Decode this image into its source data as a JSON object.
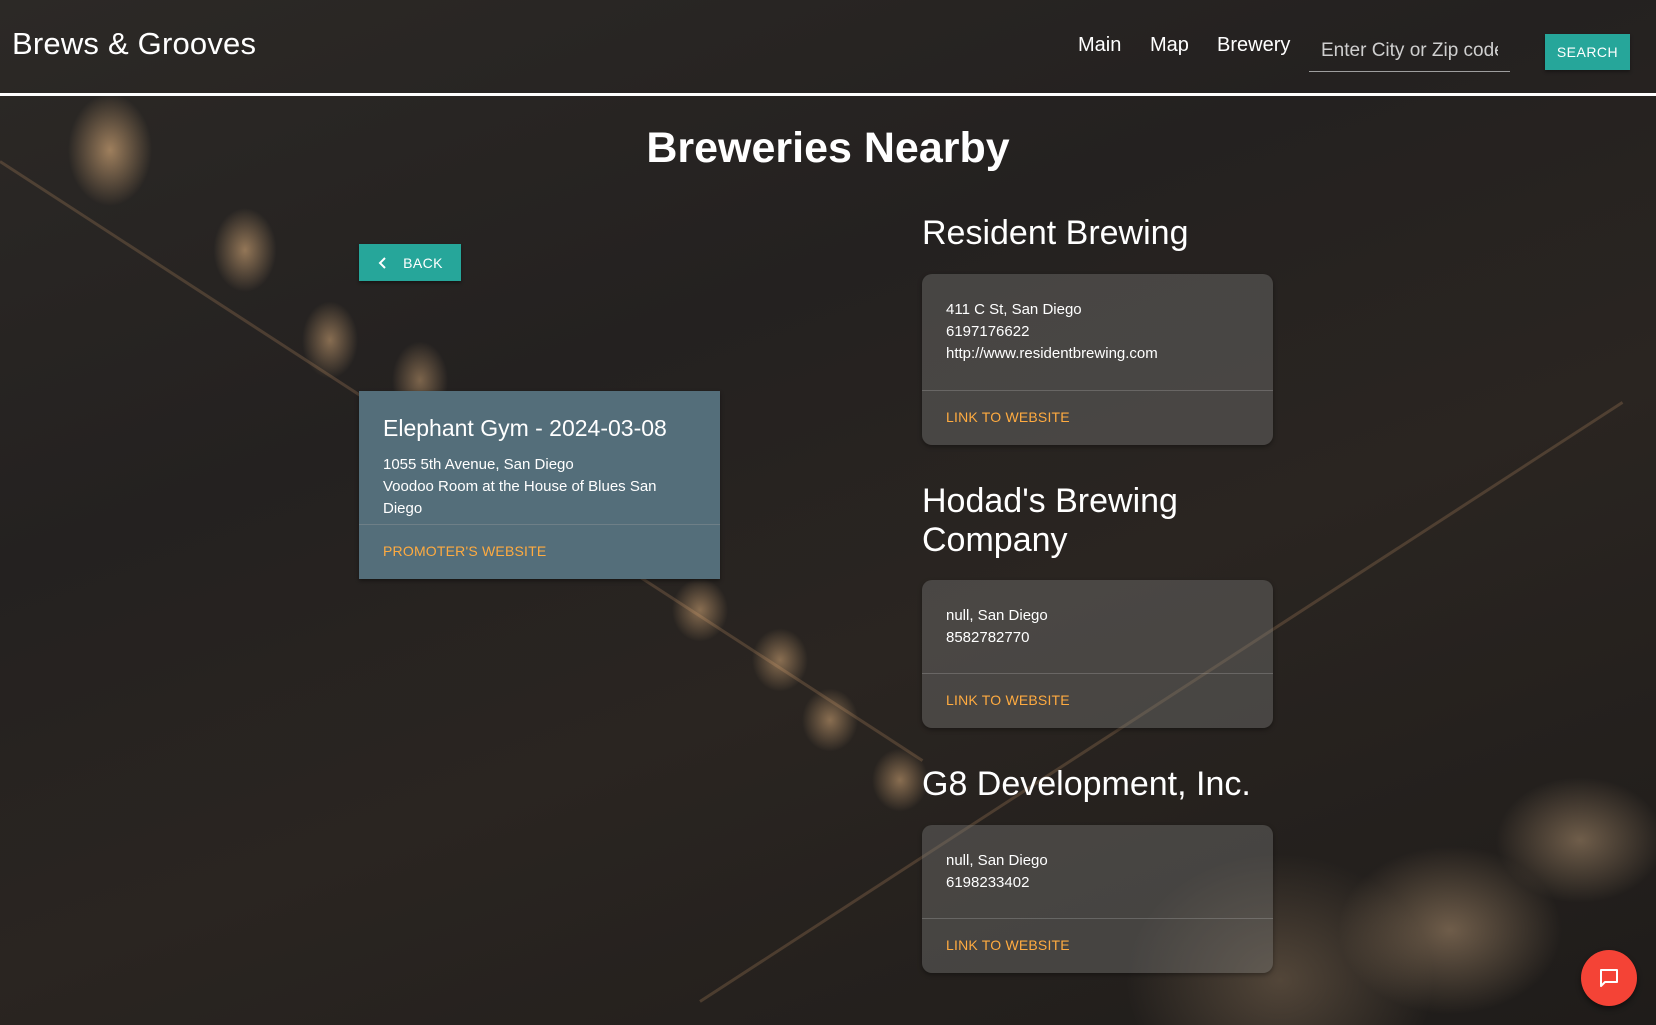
{
  "navbar": {
    "brand": "Brews & Grooves",
    "links": [
      {
        "label": "Main"
      },
      {
        "label": "Map"
      },
      {
        "label": "Brewery"
      }
    ],
    "search": {
      "placeholder": "Enter City or Zip code!",
      "value": "",
      "button_label": "SEARCH"
    }
  },
  "page_title": "Breweries Nearby",
  "back_button": {
    "label": "BACK",
    "icon": "chevron-left-icon"
  },
  "event": {
    "title": "Elephant Gym - 2024-03-08",
    "address": "1055 5th Avenue, San Diego",
    "venue": "Voodoo Room at the House of Blues San Diego",
    "link_label": "PROMOTER'S WEBSITE"
  },
  "breweries": [
    {
      "name": "Resident Brewing",
      "address": "411 C St, San Diego",
      "phone": "6197176622",
      "website": "http://www.residentbrewing.com",
      "link_label": "LINK TO WEBSITE"
    },
    {
      "name_line1": "Hodad's Brewing",
      "name_line2": "Company",
      "address": "null, San Diego",
      "phone": "8582782770",
      "link_label": "LINK TO WEBSITE"
    },
    {
      "name": "G8 Development, Inc.",
      "address": "null, San Diego",
      "phone": "6198233402",
      "link_label": "LINK TO WEBSITE"
    }
  ],
  "chat_fab": {
    "icon": "chat-icon"
  },
  "colors": {
    "accent_teal": "#26a69a",
    "link_orange": "#ffab40",
    "event_card": "#546e7a",
    "fab_red": "#f44336"
  }
}
